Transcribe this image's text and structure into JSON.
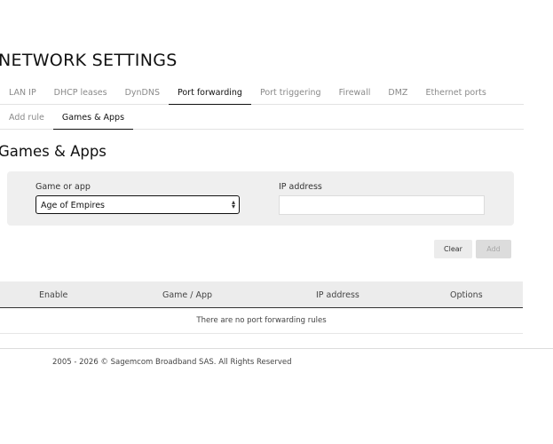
{
  "page": {
    "title": "NETWORK SETTINGS"
  },
  "tabs": [
    {
      "label": "LAN IP"
    },
    {
      "label": "DHCP leases"
    },
    {
      "label": "DynDNS"
    },
    {
      "label": "Port forwarding",
      "active": true
    },
    {
      "label": "Port triggering"
    },
    {
      "label": "Firewall"
    },
    {
      "label": "DMZ"
    },
    {
      "label": "Ethernet ports"
    }
  ],
  "subtabs": [
    {
      "label": "Add rule"
    },
    {
      "label": "Games & Apps",
      "active": true
    }
  ],
  "section": {
    "title": "Games & Apps"
  },
  "form": {
    "game_label": "Game or app",
    "game_value": "Age of Empires",
    "ip_label": "IP address",
    "ip_value": ""
  },
  "buttons": {
    "clear": "Clear",
    "add": "Add"
  },
  "table": {
    "columns": [
      "Enable",
      "Game / App",
      "IP address",
      "Options"
    ],
    "empty_message": "There are no port forwarding rules"
  },
  "footer": {
    "text": "2005 - 2026 © Sagemcom Broadband SAS. All Rights Reserved"
  }
}
